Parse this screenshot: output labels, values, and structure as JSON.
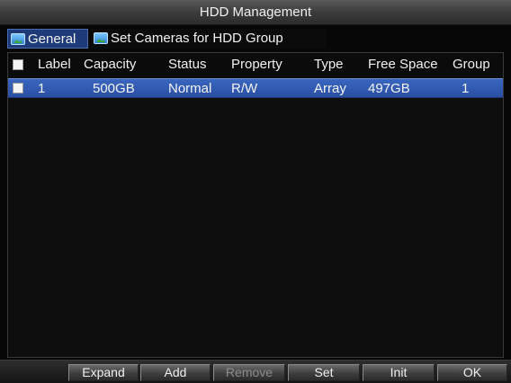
{
  "window": {
    "title": "HDD Management"
  },
  "tabs": [
    {
      "label": "General",
      "icon": "picture-icon",
      "selected": true
    },
    {
      "label": "Set Cameras for HDD Group",
      "icon": "picture-icon",
      "selected": false
    }
  ],
  "table": {
    "columns": [
      "Label",
      "Capacity",
      "Status",
      "Property",
      "Type",
      "Free Space",
      "Group"
    ],
    "rows": [
      {
        "checked": false,
        "label": "1",
        "capacity": "500GB",
        "status": "Normal",
        "property": "R/W",
        "type": "Array",
        "free_space": "497GB",
        "group": "1",
        "selected": true
      }
    ]
  },
  "buttons": {
    "expand": "Expand",
    "add": "Add",
    "remove": "Remove",
    "set": "Set",
    "init": "Init",
    "ok": "OK"
  },
  "colors": {
    "selected_row": "#2f58b0",
    "selected_tab": "#1f3a78",
    "background": "#070707"
  }
}
